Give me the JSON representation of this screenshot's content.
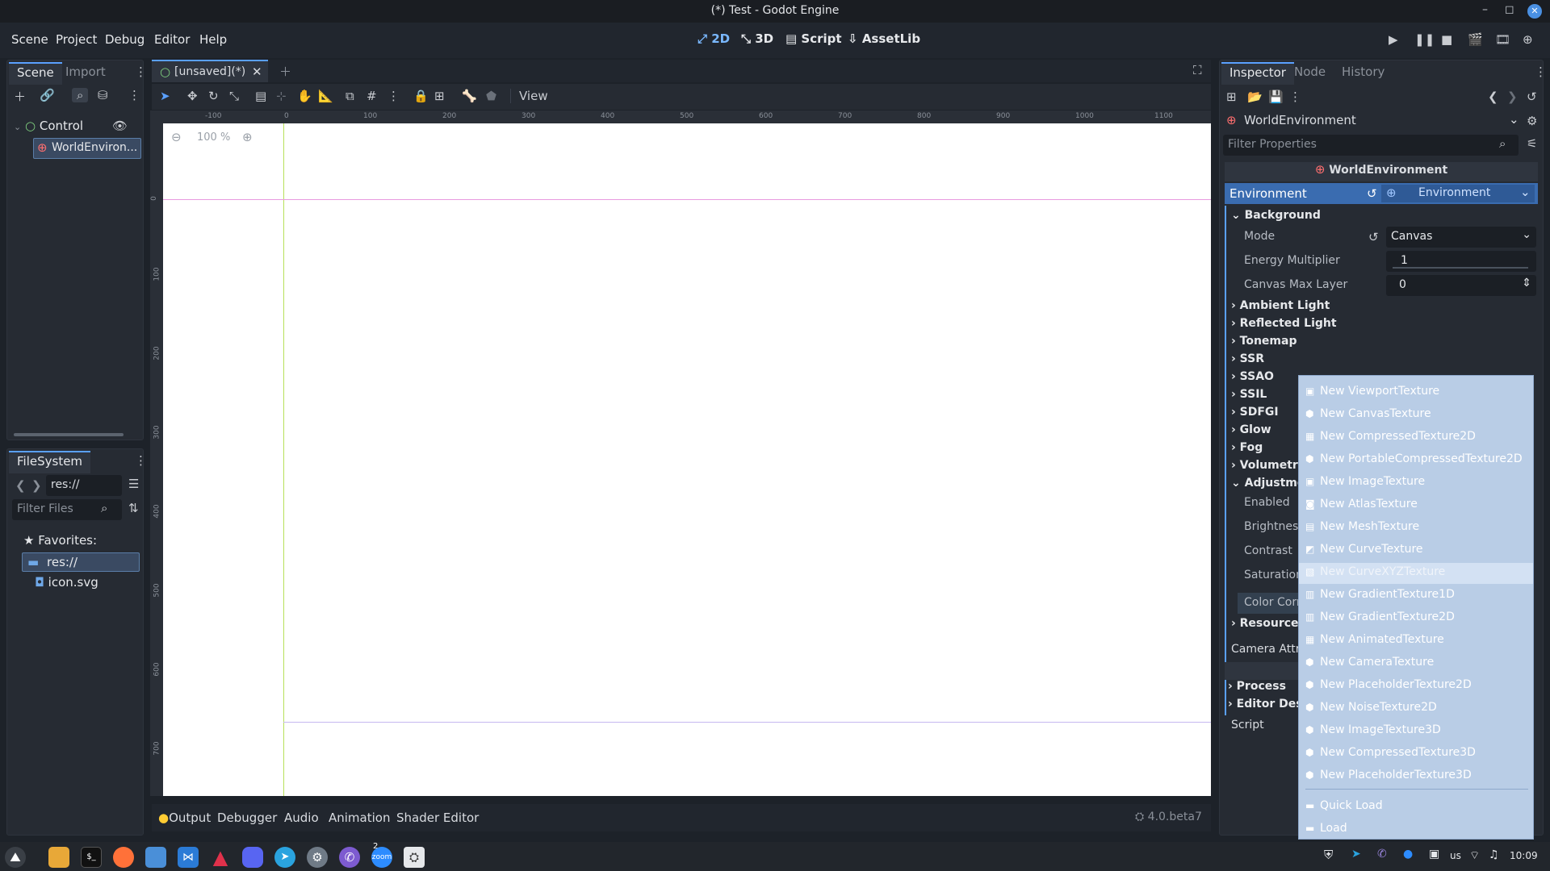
{
  "window": {
    "title": "(*) Test - Godot Engine",
    "controls": [
      "–",
      "◻",
      "✕"
    ]
  },
  "menus": [
    "Scene",
    "Project",
    "Debug",
    "Editor",
    "Help"
  ],
  "workspaces": [
    "2D",
    "3D",
    "Script",
    "AssetLib"
  ],
  "scene_panel": {
    "tabs": [
      "Scene",
      "Import"
    ],
    "tree": [
      {
        "label": "Control"
      },
      {
        "label": "WorldEnviron..."
      }
    ]
  },
  "filesystem": {
    "tab": "FileSystem",
    "path": "res://",
    "filter_placeholder": "Filter Files",
    "items": [
      "Favorites:",
      "res://",
      "icon.svg"
    ]
  },
  "editor": {
    "tab_label": "[unsaved](*)",
    "zoom": "100 %",
    "view_label": "View",
    "ruler_h": [
      "-100",
      "0",
      "100",
      "200",
      "300",
      "400",
      "500",
      "600",
      "700",
      "800",
      "900",
      "1000",
      "1100"
    ],
    "ruler_v": [
      "0",
      "100",
      "200",
      "300",
      "400",
      "500",
      "600",
      "700"
    ]
  },
  "bottom_panel": {
    "items": [
      "Output",
      "Debugger",
      "Audio",
      "Animation",
      "Shader Editor"
    ],
    "version": "4.0.beta7"
  },
  "inspector": {
    "tabs": [
      "Inspector",
      "Node",
      "History"
    ],
    "object": "WorldEnvironment",
    "filter_placeholder": "Filter Properties",
    "header": "WorldEnvironment",
    "environment_label": "Environment",
    "environment_value": "Environment",
    "background_section": "Background",
    "mode_label": "Mode",
    "mode_value": "Canvas",
    "energy_label": "Energy Multiplier",
    "energy_value": "1",
    "canvas_layer_label": "Canvas Max Layer",
    "canvas_layer_value": "0",
    "sections": [
      "Ambient Light",
      "Reflected Light",
      "Tonemap",
      "SSR",
      "SSAO",
      "SSIL",
      "SDFGI",
      "Glow",
      "Fog",
      "Volumetric",
      "Adjustmen"
    ],
    "adj_rows": [
      "Enabled",
      "Brightness",
      "Contrast",
      "Saturation",
      "Color Corr"
    ],
    "resource": "Resource",
    "camera": "Camera Attri",
    "process": "Process",
    "editor_desc": "Editor Desc",
    "script": "Script"
  },
  "dropdown": {
    "items": [
      "New ViewportTexture",
      "New CanvasTexture",
      "New CompressedTexture2D",
      "New PortableCompressedTexture2D",
      "New ImageTexture",
      "New AtlasTexture",
      "New MeshTexture",
      "New CurveTexture",
      "New CurveXYZTexture",
      "New GradientTexture1D",
      "New GradientTexture2D",
      "New AnimatedTexture",
      "New CameraTexture",
      "New PlaceholderTexture2D",
      "New NoiseTexture2D",
      "New ImageTexture3D",
      "New CompressedTexture3D",
      "New PlaceholderTexture3D"
    ],
    "highlighted_index": 8,
    "footer": [
      "Quick Load",
      "Load"
    ]
  },
  "taskbar": {
    "tray": {
      "lang": "us",
      "time": "10:09"
    },
    "zoom_badge": "2",
    "zoom_label": "zoom"
  },
  "colors": {
    "accent": "#5aa0ff",
    "dropdown_bg": "#b9cde6",
    "selection": "#3a4a62"
  }
}
